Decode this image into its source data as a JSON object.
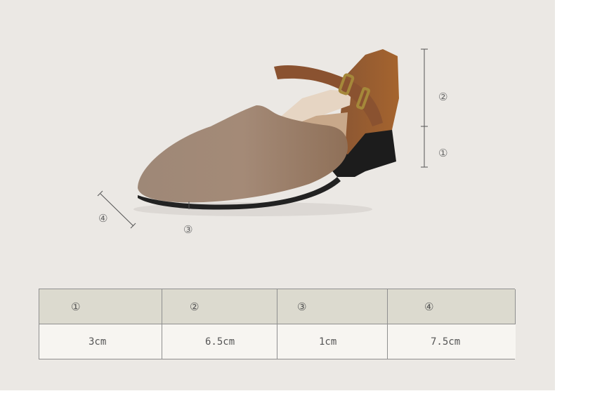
{
  "markers": {
    "toe_depth": "④",
    "heel_height": "①",
    "upper_height": "②",
    "sole_thickness": "③"
  },
  "table": {
    "headers": [
      "①",
      "②",
      "③",
      "④"
    ],
    "values": [
      "3cm",
      "6.5cm",
      "1cm",
      "7.5cm"
    ]
  }
}
